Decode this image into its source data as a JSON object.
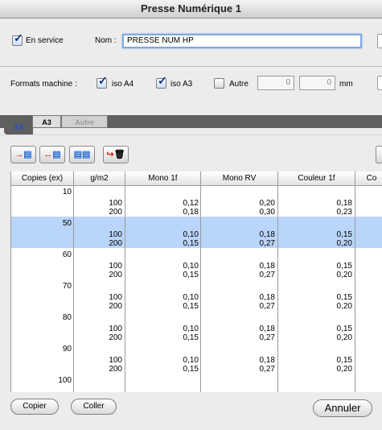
{
  "window": {
    "title": "Presse Numérique  1"
  },
  "general": {
    "en_service_label": "En service",
    "en_service_checked": true,
    "nom_label": "Nom :",
    "nom_value": "PRESSE NUM HP"
  },
  "formats": {
    "label": "Formats machine :",
    "iso_a4": {
      "label": "iso A4",
      "checked": true
    },
    "iso_a3": {
      "label": "iso A3",
      "checked": true
    },
    "autre": {
      "label": "Autre",
      "checked": false,
      "width_value": "0",
      "height_value": "0",
      "unit": "mm"
    }
  },
  "tabs": [
    {
      "label": "A4",
      "active": true
    },
    {
      "label": "A3",
      "active": false
    },
    {
      "label": "Autre",
      "active": false,
      "disabled": true
    }
  ],
  "toolbar": {
    "icons": [
      "insert-row-icon",
      "swap-columns-icon",
      "copy-columns-icon",
      "delete-row-icon"
    ]
  },
  "table": {
    "headers": [
      "Copies (ex)",
      "g/m2",
      "Mono 1f",
      "Mono RV",
      "Couleur 1f",
      "Co"
    ],
    "groups": [
      {
        "copies": "10",
        "selected": false,
        "rows": [
          [
            "100",
            "0,12",
            "0,20",
            "0,18"
          ],
          [
            "200",
            "0,18",
            "0,30",
            "0,23"
          ]
        ]
      },
      {
        "copies": "50",
        "selected": true,
        "rows": [
          [
            "100",
            "0,10",
            "0,18",
            "0,15"
          ],
          [
            "200",
            "0,15",
            "0,27",
            "0,20"
          ]
        ]
      },
      {
        "copies": "60",
        "selected": false,
        "rows": [
          [
            "100",
            "0,10",
            "0,18",
            "0,15"
          ],
          [
            "200",
            "0,15",
            "0,27",
            "0,20"
          ]
        ]
      },
      {
        "copies": "70",
        "selected": false,
        "rows": [
          [
            "100",
            "0,10",
            "0,18",
            "0,15"
          ],
          [
            "200",
            "0,15",
            "0,27",
            "0,20"
          ]
        ]
      },
      {
        "copies": "80",
        "selected": false,
        "rows": [
          [
            "100",
            "0,10",
            "0,18",
            "0,15"
          ],
          [
            "200",
            "0,15",
            "0,27",
            "0,20"
          ]
        ]
      },
      {
        "copies": "90",
        "selected": false,
        "rows": [
          [
            "100",
            "0,10",
            "0,18",
            "0,15"
          ],
          [
            "200",
            "0,15",
            "0,27",
            "0,20"
          ]
        ]
      },
      {
        "copies": "100",
        "selected": false,
        "rows": []
      }
    ]
  },
  "footer": {
    "copier_label": "Copier",
    "coller_label": "Coller",
    "annuler_label": "Annuler"
  },
  "colors": {
    "selection": "#b9d5f9",
    "tab_bar": "#5f5f5f",
    "active_tab_text": "#1f4fd6"
  }
}
